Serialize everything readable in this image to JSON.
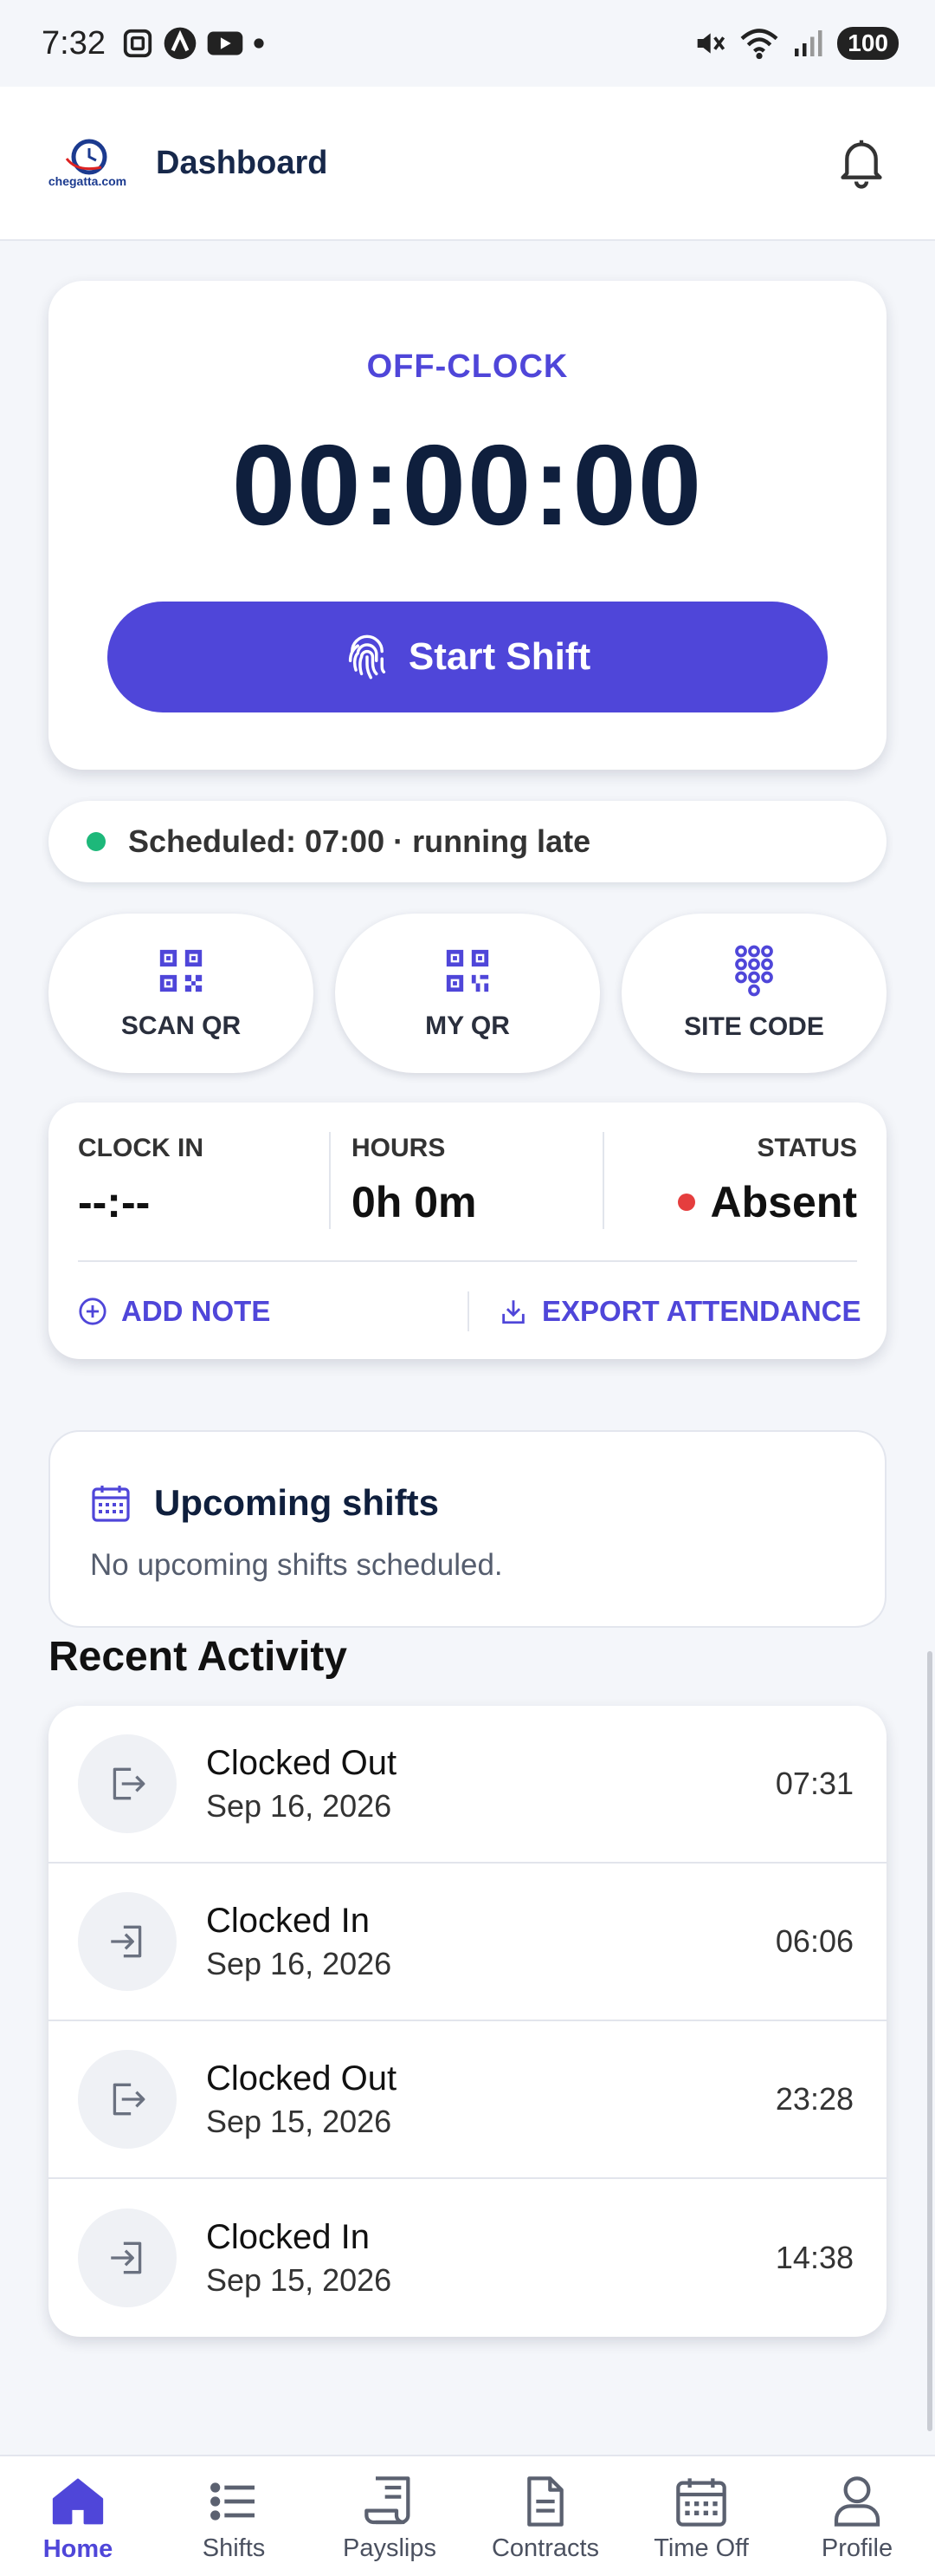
{
  "status_bar": {
    "time": "7:32",
    "battery": "100",
    "left_icons": [
      "screenshot-icon",
      "a-icon",
      "youtube-icon",
      "dot-icon"
    ],
    "right_icons": [
      "mute-icon",
      "wifi-icon",
      "signal-icon"
    ]
  },
  "app_bar": {
    "logo_text": "chegatta.com",
    "title": "Dashboard",
    "notification_icon": "bell-icon"
  },
  "clock": {
    "state": "OFF-CLOCK",
    "timer": "00:00:00",
    "start_label": "Start Shift",
    "start_icon": "fingerprint-icon"
  },
  "schedule": {
    "text": "Scheduled: 07:00 · running late",
    "status_color": "#1db87a"
  },
  "actions": [
    {
      "label": "SCAN QR",
      "icon": "qr-scan-icon"
    },
    {
      "label": "MY QR",
      "icon": "qr-code-icon"
    },
    {
      "label": "SITE CODE",
      "icon": "keypad-icon"
    }
  ],
  "stats": {
    "clock_in_label": "CLOCK IN",
    "clock_in_value": "--:--",
    "hours_label": "HOURS",
    "hours_value": "0h 0m",
    "status_label": "STATUS",
    "status_value": "Absent",
    "status_color": "#e53e3e",
    "add_note": "ADD NOTE",
    "export": "EXPORT ATTENDANCE"
  },
  "upcoming": {
    "title": "Upcoming shifts",
    "empty_text": "No upcoming shifts scheduled."
  },
  "recent": {
    "title": "Recent Activity",
    "items": [
      {
        "title": "Clocked Out",
        "date": "Sep 16, 2026",
        "time": "07:31",
        "icon": "logout-icon"
      },
      {
        "title": "Clocked In",
        "date": "Sep 16, 2026",
        "time": "06:06",
        "icon": "login-icon"
      },
      {
        "title": "Clocked Out",
        "date": "Sep 15, 2026",
        "time": "23:28",
        "icon": "logout-icon"
      },
      {
        "title": "Clocked In",
        "date": "Sep 15, 2026",
        "time": "14:38",
        "icon": "login-icon"
      }
    ]
  },
  "nav": [
    {
      "label": "Home",
      "icon": "home-icon",
      "active": true
    },
    {
      "label": "Shifts",
      "icon": "list-icon",
      "active": false
    },
    {
      "label": "Payslips",
      "icon": "receipt-icon",
      "active": false
    },
    {
      "label": "Contracts",
      "icon": "document-icon",
      "active": false
    },
    {
      "label": "Time Off",
      "icon": "calendar-icon",
      "active": false
    },
    {
      "label": "Profile",
      "icon": "person-icon",
      "active": false
    }
  ],
  "colors": {
    "accent": "#4f46d9",
    "text_dark": "#0f1f3d",
    "background": "#f4f6fa"
  }
}
